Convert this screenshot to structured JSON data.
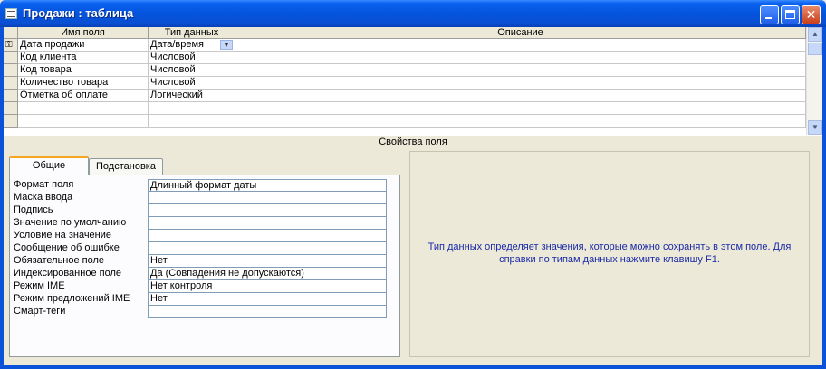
{
  "window": {
    "title": "Продажи : таблица"
  },
  "grid": {
    "headers": [
      "Имя поля",
      "Тип данных",
      "Описание"
    ],
    "rows": [
      {
        "name": "Дата продажи",
        "type": "Дата/время",
        "description": ""
      },
      {
        "name": "Код клиента",
        "type": "Числовой",
        "description": ""
      },
      {
        "name": "Код товара",
        "type": "Числовой",
        "description": ""
      },
      {
        "name": "Количество товара",
        "type": "Числовой",
        "description": ""
      },
      {
        "name": "Отметка об оплате",
        "type": "Логический",
        "description": ""
      },
      {
        "name": "",
        "type": "",
        "description": ""
      },
      {
        "name": "",
        "type": "",
        "description": ""
      }
    ]
  },
  "properties": {
    "header": "Свойства поля",
    "tabs": [
      "Общие",
      "Подстановка"
    ],
    "active_tab": "Общие",
    "rows": [
      {
        "label": "Формат поля",
        "value": "Длинный формат даты"
      },
      {
        "label": "Маска ввода",
        "value": ""
      },
      {
        "label": "Подпись",
        "value": ""
      },
      {
        "label": "Значение по умолчанию",
        "value": ""
      },
      {
        "label": "Условие на значение",
        "value": ""
      },
      {
        "label": "Сообщение об ошибке",
        "value": ""
      },
      {
        "label": "Обязательное поле",
        "value": "Нет"
      },
      {
        "label": "Индексированное поле",
        "value": "Да (Совпадения не допускаются)"
      },
      {
        "label": "Режим IME",
        "value": "Нет контроля"
      },
      {
        "label": "Режим предложений IME",
        "value": "Нет"
      },
      {
        "label": "Смарт-теги",
        "value": ""
      }
    ],
    "help_text": "Тип данных определяет значения, которые можно сохранять в этом поле.  Для справки по типам данных нажмите клавишу F1."
  },
  "icons": {
    "title_icon": "table-icon",
    "primary_key": "key-icon",
    "dropdown": "chevron-down-icon",
    "scroll_up": "arrow-up-icon",
    "scroll_down": "arrow-down-icon"
  },
  "colors": {
    "titlebar": "#0453DC",
    "window_bg": "#ECE9D8",
    "help_text": "#1A2AA8",
    "active_tab_accent": "#F5A623"
  }
}
